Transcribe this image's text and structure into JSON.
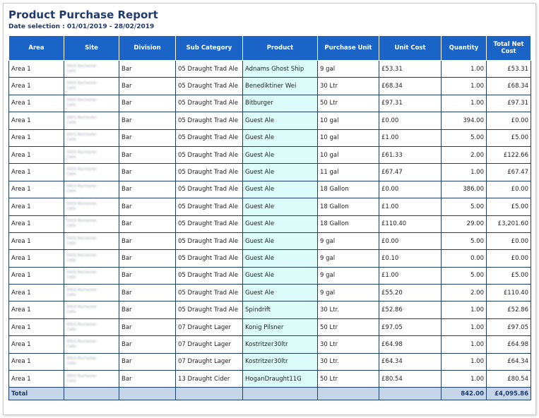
{
  "report": {
    "title": "Product Purchase Report",
    "date_selection": "Date selection : 01/01/2019 - 28/02/2019"
  },
  "columns": [
    "Area",
    "Site",
    "Division",
    "Sub Category",
    "Product",
    "Purchase Unit",
    "Unit Cost",
    "Quantity",
    "Total Net Cost"
  ],
  "rows": [
    {
      "area": "Area 1",
      "site": "0003 Rochester Cello",
      "division": "Bar",
      "sub_category": "05 Draught Trad Ale",
      "product": "Adnams Ghost Ship",
      "purchase_unit": "9 gal",
      "unit_cost": "£53.31",
      "quantity": "1.00",
      "total_net_cost": "£53.31"
    },
    {
      "area": "Area 1",
      "site": "0003 Rochester Cello",
      "division": "Bar",
      "sub_category": "05 Draught Trad Ale",
      "product": "Benediktiner Wei",
      "purchase_unit": "30 Ltr",
      "unit_cost": "£68.34",
      "quantity": "1.00",
      "total_net_cost": "£68.34"
    },
    {
      "area": "Area 1",
      "site": "0003 Rochester Cello",
      "division": "Bar",
      "sub_category": "05 Draught Trad Ale",
      "product": "Bitburger",
      "purchase_unit": "50 Ltr",
      "unit_cost": "£97.31",
      "quantity": "1.00",
      "total_net_cost": "£97.31"
    },
    {
      "area": "Area 1",
      "site": "0003 Rochester Cello",
      "division": "Bar",
      "sub_category": "05 Draught Trad Ale",
      "product": "Guest Ale",
      "purchase_unit": "10 gal",
      "unit_cost": "£0.00",
      "quantity": "394.00",
      "total_net_cost": "£0.00"
    },
    {
      "area": "Area 1",
      "site": "0003 Rochester Cello",
      "division": "Bar",
      "sub_category": "05 Draught Trad Ale",
      "product": "Guest Ale",
      "purchase_unit": "10 gal",
      "unit_cost": "£1.00",
      "quantity": "5.00",
      "total_net_cost": "£5.00"
    },
    {
      "area": "Area 1",
      "site": "0003 Rochester Cello",
      "division": "Bar",
      "sub_category": "05 Draught Trad Ale",
      "product": "Guest Ale",
      "purchase_unit": "10 gal",
      "unit_cost": "£61.33",
      "quantity": "2.00",
      "total_net_cost": "£122.66"
    },
    {
      "area": "Area 1",
      "site": "0003 Rochester Cello",
      "division": "Bar",
      "sub_category": "05 Draught Trad Ale",
      "product": "Guest Ale",
      "purchase_unit": "11 gal",
      "unit_cost": "£67.47",
      "quantity": "1.00",
      "total_net_cost": "£67.47"
    },
    {
      "area": "Area 1",
      "site": "0003 Rochester Cello",
      "division": "Bar",
      "sub_category": "05 Draught Trad Ale",
      "product": "Guest Ale",
      "purchase_unit": "18 Gallon",
      "unit_cost": "£0.00",
      "quantity": "386.00",
      "total_net_cost": "£0.00"
    },
    {
      "area": "Area 1",
      "site": "0003 Rochester Cello",
      "division": "Bar",
      "sub_category": "05 Draught Trad Ale",
      "product": "Guest Ale",
      "purchase_unit": "18 Gallon",
      "unit_cost": "£1.00",
      "quantity": "5.00",
      "total_net_cost": "£5.00"
    },
    {
      "area": "Area 1",
      "site": "0003 Rochester Cello",
      "division": "Bar",
      "sub_category": "05 Draught Trad Ale",
      "product": "Guest Ale",
      "purchase_unit": "18 Gallon",
      "unit_cost": "£110.40",
      "quantity": "29.00",
      "total_net_cost": "£3,201.60"
    },
    {
      "area": "Area 1",
      "site": "0003 Rochester Cello",
      "division": "Bar",
      "sub_category": "05 Draught Trad Ale",
      "product": "Guest Ale",
      "purchase_unit": "9 gal",
      "unit_cost": "£0.00",
      "quantity": "5.00",
      "total_net_cost": "£0.00"
    },
    {
      "area": "Area 1",
      "site": "0003 Rochester Cello",
      "division": "Bar",
      "sub_category": "05 Draught Trad Ale",
      "product": "Guest Ale",
      "purchase_unit": "9 gal",
      "unit_cost": "£0.10",
      "quantity": "0.00",
      "total_net_cost": "£0.00"
    },
    {
      "area": "Area 1",
      "site": "0003 Rochester Cello",
      "division": "Bar",
      "sub_category": "05 Draught Trad Ale",
      "product": "Guest Ale",
      "purchase_unit": "9 gal",
      "unit_cost": "£1.00",
      "quantity": "5.00",
      "total_net_cost": "£5.00"
    },
    {
      "area": "Area 1",
      "site": "0003 Rochester Cello",
      "division": "Bar",
      "sub_category": "05 Draught Trad Ale",
      "product": "Guest Ale",
      "purchase_unit": "9 gal",
      "unit_cost": "£55.20",
      "quantity": "2.00",
      "total_net_cost": "£110.40"
    },
    {
      "area": "Area 1",
      "site": "0003 Rochester Cello",
      "division": "Bar",
      "sub_category": "05 Draught Trad Ale",
      "product": "Spindrift",
      "purchase_unit": "30 Ltr.",
      "unit_cost": "£52.86",
      "quantity": "1.00",
      "total_net_cost": "£52.86"
    },
    {
      "area": "Area 1",
      "site": "0003 Rochester Cello",
      "division": "Bar",
      "sub_category": "07 Draught Lager",
      "product": "Konig Pilsner",
      "purchase_unit": "50 Ltr",
      "unit_cost": "£97.05",
      "quantity": "1.00",
      "total_net_cost": "£97.05"
    },
    {
      "area": "Area 1",
      "site": "0003 Rochester Cello",
      "division": "Bar",
      "sub_category": "07 Draught Lager",
      "product": "Kostritzer30ltr",
      "purchase_unit": "30 Ltr",
      "unit_cost": "£64.98",
      "quantity": "1.00",
      "total_net_cost": "£64.98"
    },
    {
      "area": "Area 1",
      "site": "0003 Rochester Cello",
      "division": "Bar",
      "sub_category": "07 Draught Lager",
      "product": "Kostritzer30ltr",
      "purchase_unit": "30 Ltr.",
      "unit_cost": "£64.34",
      "quantity": "1.00",
      "total_net_cost": "£64.34"
    },
    {
      "area": "Area 1",
      "site": "0003 Rochester Cello",
      "division": "Bar",
      "sub_category": "13 Draught Cider",
      "product": "HoganDraught11G",
      "purchase_unit": "50 Ltr",
      "unit_cost": "£80.54",
      "quantity": "1.00",
      "total_net_cost": "£80.54"
    }
  ],
  "total": {
    "label": "Total",
    "quantity": "842.00",
    "total_net_cost": "£4,095.86"
  },
  "colors": {
    "header_bg": "#1a64c8",
    "product_bg": "#dcfcfa",
    "total_bg": "#c5d6e8",
    "title": "#1f3a6e"
  }
}
